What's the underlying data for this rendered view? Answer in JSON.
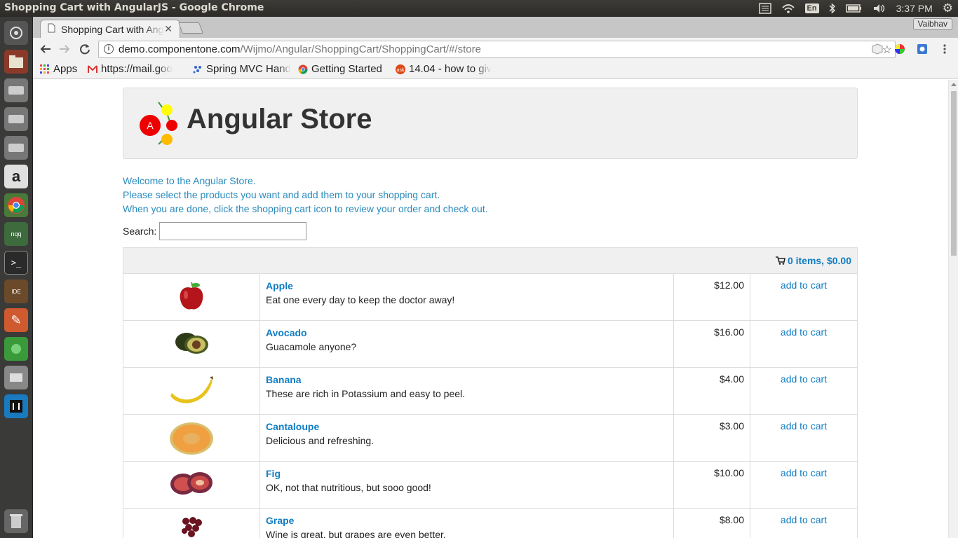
{
  "os_panel": {
    "window_title": "Shopping Cart with AngularJS - Google Chrome",
    "keyboard_layout": "En",
    "time": "3:37 PM"
  },
  "browser": {
    "tab_title": "Shopping Cart with AngularJS",
    "profile_name": "Vaibhav",
    "url_domain": "demo.componentone.com",
    "url_path": "/Wijmo/Angular/ShoppingCart/ShoppingCart/#/store",
    "bookmarks": [
      {
        "label": "Apps",
        "icon": "apps-grid-icon"
      },
      {
        "label": "https://mail.goo",
        "icon": "gmail-icon"
      },
      {
        "label": "Spring MVC Hand",
        "icon": "spring-icon"
      },
      {
        "label": "Getting Started",
        "icon": "chrome-icon"
      },
      {
        "label": "14.04 - how to giv",
        "icon": "askubuntu-icon"
      }
    ]
  },
  "store": {
    "title": "Angular Store",
    "logo_letter": "A",
    "welcome_lines": [
      "Welcome to the Angular Store.",
      "Please select the products you want and add them to your shopping cart.",
      "When you are done, click the shopping cart icon to review your order and check out."
    ],
    "search_label": "Search:",
    "search_value": "",
    "cart_summary": "0 items, $0.00",
    "add_label": "add to cart",
    "products": [
      {
        "name": "Apple",
        "description": "Eat one every day to keep the doctor away!",
        "price": "$12.00",
        "color": "#b3151b"
      },
      {
        "name": "Avocado",
        "description": "Guacamole anyone?",
        "price": "$16.00",
        "color": "#4a5a22"
      },
      {
        "name": "Banana",
        "description": "These are rich in Potassium and easy to peel.",
        "price": "$4.00",
        "color": "#e8c21c"
      },
      {
        "name": "Cantaloupe",
        "description": "Delicious and refreshing.",
        "price": "$3.00",
        "color": "#f0a040"
      },
      {
        "name": "Fig",
        "description": "OK, not that nutritious, but sooo good!",
        "price": "$10.00",
        "color": "#7a2a40"
      },
      {
        "name": "Grape",
        "description": "Wine is great, but grapes are even better.",
        "price": "$8.00",
        "color": "#6a1420"
      }
    ]
  }
}
